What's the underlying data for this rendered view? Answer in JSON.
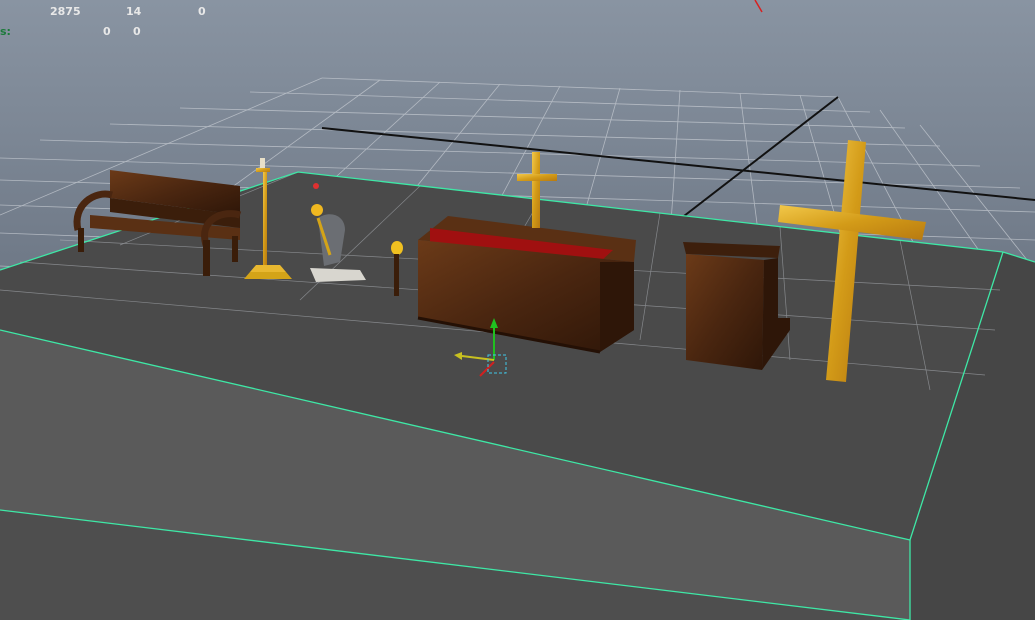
{
  "hud": {
    "row1": {
      "verts": "2875",
      "edges": "14",
      "faces": "0"
    },
    "row2": {
      "label": "s:",
      "a": "0",
      "b": "0"
    }
  },
  "colors": {
    "background": "#6a7482",
    "grid": "#c8ccd2",
    "selection_wire": "#3ee8a6",
    "floor_top": "#4a4a4a",
    "floor_side": "#5a5a5a",
    "wood": "#4a2610",
    "gold": "#d4a418",
    "red_cloth": "#a01010"
  },
  "scene": {
    "objects": [
      "bench",
      "candle-stand",
      "kneeling-figure",
      "torch",
      "altar",
      "altar-cross",
      "lectern",
      "large-cross"
    ],
    "manipulator": "move-tool"
  }
}
